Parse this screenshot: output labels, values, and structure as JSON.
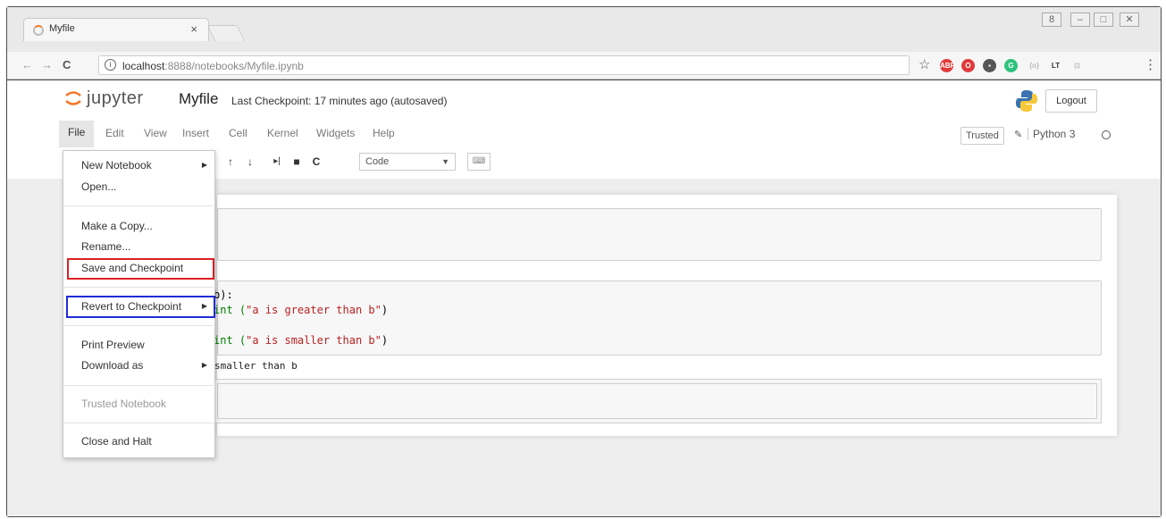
{
  "browser": {
    "tab_title": "Myfile",
    "tab_close": "×",
    "url_host": "localhost",
    "url_path": ":8888/notebooks/Myfile.ipynb",
    "info_icon": "i",
    "back": "←",
    "forward": "→",
    "reload": "C",
    "star": "☆",
    "menu": "⋮",
    "window_controls": [
      "8",
      "–",
      "□",
      "✕"
    ],
    "extension_icons": [
      {
        "name": "abp-icon",
        "color": "#e03a3a",
        "label": "ABP"
      },
      {
        "name": "opera-icon",
        "color": "#e03a3a",
        "label": "O"
      },
      {
        "name": "ext-dark-icon",
        "color": "#555555",
        "label": "▪"
      },
      {
        "name": "grammarly-icon",
        "color": "#2ec27e",
        "label": "G"
      },
      {
        "name": "ext-brackets-icon",
        "color": "#bbbbbb",
        "label": "{o}"
      },
      {
        "name": "languagetool-icon",
        "color": "#333333",
        "label": "LT"
      },
      {
        "name": "ext-gray-icon",
        "color": "#bbbbbb",
        "label": "⊡"
      }
    ]
  },
  "jupyter": {
    "logo_text": "jupyter",
    "notebook_name": "Myfile",
    "checkpoint_text": "Last Checkpoint: 17 minutes ago (autosaved)",
    "logout_label": "Logout",
    "menu": [
      "File",
      "Edit",
      "View",
      "Insert",
      "Cell",
      "Kernel",
      "Widgets",
      "Help"
    ],
    "trusted_label": "Trusted",
    "kernel_name": "Python 3",
    "toolbar": {
      "up": "↑",
      "down": "↓",
      "run": "▸|",
      "stop": "■",
      "restart": "C",
      "cell_type": "Code",
      "dropdown_arrow": "▼",
      "keyboard": "⌨"
    }
  },
  "code_cell": {
    "line1": "b):",
    "line2_pre": "int (",
    "line2_str": "\"a is greater than b\"",
    "line2_post": ")",
    "line3_pre": "int (",
    "line3_str": "\"a is smaller than b\"",
    "line3_post": ")",
    "output": "smaller than b"
  },
  "file_menu": {
    "items": [
      {
        "label": "New Notebook",
        "submenu": true
      },
      {
        "label": "Open..."
      },
      {
        "label": "Make a Copy..."
      },
      {
        "label": "Rename..."
      },
      {
        "label": "Save and Checkpoint"
      },
      {
        "label": "Revert to Checkpoint",
        "submenu": true
      },
      {
        "label": "Print Preview"
      },
      {
        "label": "Download as",
        "submenu": true
      },
      {
        "label": "Trusted Notebook",
        "disabled": true
      },
      {
        "label": "Close and Halt"
      }
    ],
    "submenu_arrow": "▶"
  },
  "highlight_colors": {
    "save": "#dd1f26",
    "revert": "#1f2bd6"
  }
}
